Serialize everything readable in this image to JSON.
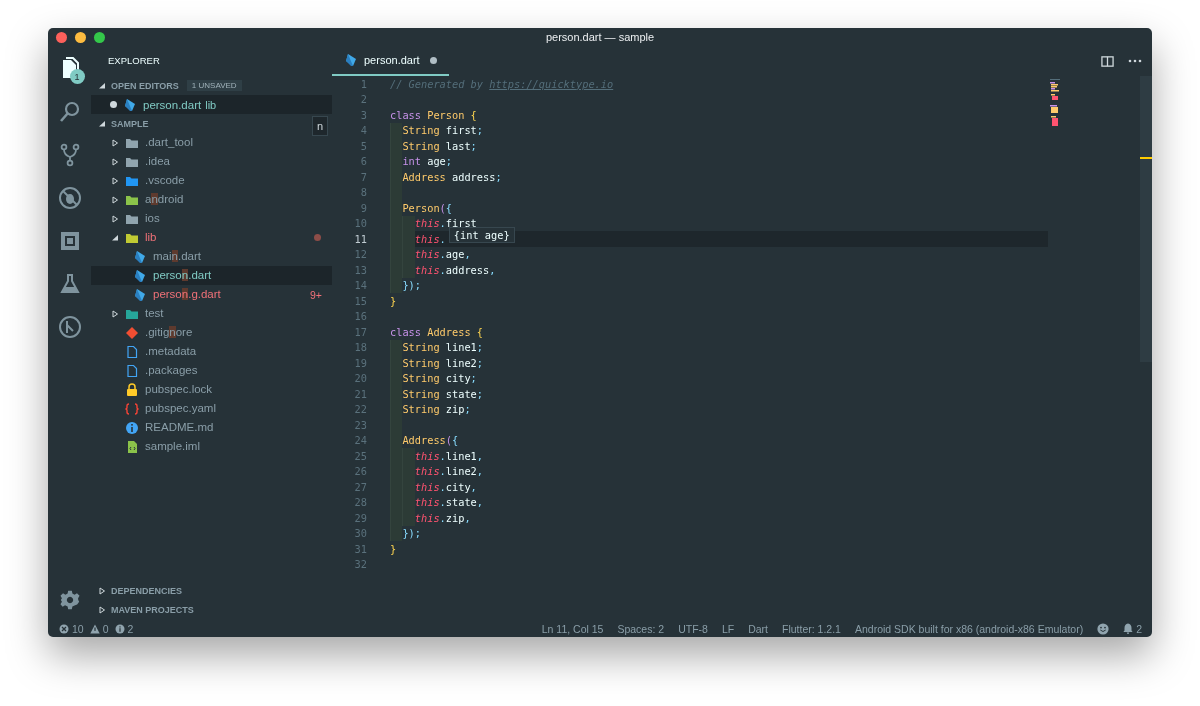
{
  "window": {
    "title": "person.dart — sample"
  },
  "activity_bar": {
    "items": [
      {
        "kind": "files",
        "selected": true,
        "badge": "1"
      },
      {
        "kind": "search",
        "selected": false
      },
      {
        "kind": "source-control",
        "selected": false
      },
      {
        "kind": "debug",
        "selected": false
      },
      {
        "kind": "extensions",
        "selected": false
      },
      {
        "kind": "flask",
        "selected": false
      },
      {
        "kind": "flutter",
        "selected": false
      }
    ]
  },
  "sidebar": {
    "title": "EXPLORER",
    "filter": "n",
    "open_editors": {
      "title": "OPEN EDITORS",
      "badge": "1 UNSAVED",
      "expanded": true,
      "items": [
        {
          "name": "person.dart",
          "folder": "lib",
          "dirty": true,
          "kind": "dart",
          "selected": true
        }
      ]
    },
    "project": {
      "title": "SAMPLE",
      "expanded": true,
      "items": [
        {
          "kind": "folder",
          "name": ".dart_tool",
          "expanded": false,
          "selected": false,
          "modified": false,
          "error": false
        },
        {
          "kind": "folder",
          "name": ".idea",
          "expanded": false,
          "selected": false,
          "modified": false,
          "error": false
        },
        {
          "kind": "folder-vscode",
          "name": ".vscode",
          "expanded": false,
          "selected": false,
          "modified": false,
          "error": false
        },
        {
          "kind": "folder-android",
          "name": "android",
          "expanded": false,
          "selected": false,
          "modified": false,
          "error": false
        },
        {
          "kind": "folder-ios",
          "name": "ios",
          "expanded": false,
          "selected": false,
          "modified": false,
          "error": false
        },
        {
          "kind": "folder-lib",
          "name": "lib",
          "expanded": true,
          "selected": false,
          "modified": false,
          "error": true,
          "children": [
            {
              "kind": "dart",
              "name": "main.dart",
              "selected": false,
              "modified": false,
              "error": false
            },
            {
              "kind": "dart",
              "name": "person.dart",
              "selected": true,
              "modified": true,
              "error": false
            },
            {
              "kind": "dart",
              "name": "person.g.dart",
              "selected": false,
              "modified": false,
              "error": true,
              "badge": "9+"
            }
          ]
        },
        {
          "kind": "folder-test",
          "name": "test",
          "expanded": false,
          "selected": false,
          "modified": false,
          "error": false
        },
        {
          "kind": "git",
          "name": ".gitignore",
          "selected": false,
          "modified": false,
          "error": false
        },
        {
          "kind": "file",
          "name": ".metadata",
          "selected": false,
          "modified": false,
          "error": false
        },
        {
          "kind": "file",
          "name": ".packages",
          "selected": false,
          "modified": false,
          "error": false
        },
        {
          "kind": "lock",
          "name": "pubspec.lock",
          "selected": false,
          "modified": false,
          "error": false
        },
        {
          "kind": "yaml",
          "name": "pubspec.yaml",
          "selected": false,
          "modified": false,
          "error": false
        },
        {
          "kind": "info",
          "name": "README.md",
          "selected": false,
          "modified": false,
          "error": false
        },
        {
          "kind": "xml",
          "name": "sample.iml",
          "selected": false,
          "modified": false,
          "error": false
        }
      ]
    },
    "sections": [
      {
        "title": "DEPENDENCIES",
        "expanded": false
      },
      {
        "title": "MAVEN PROJECTS",
        "expanded": false
      }
    ]
  },
  "editor": {
    "tabs": [
      {
        "name": "person.dart",
        "kind": "dart",
        "dirty": true,
        "selected": true
      }
    ],
    "lines": [
      {
        "number": "1",
        "current": false,
        "tokens": [
          {
            "kind": "comment",
            "text": "// Generated by "
          },
          {
            "kind": "link",
            "text": "https://quicktype.io"
          }
        ]
      },
      {
        "number": "2",
        "current": false
      },
      {
        "number": "3",
        "current": false,
        "tokens": [
          {
            "kind": "keyword",
            "text": "class "
          },
          {
            "kind": "type",
            "text": "Person "
          },
          {
            "kind": "brace",
            "text": "{"
          }
        ],
        "children": [
          {
            "number": "4",
            "current": false,
            "tokens": [
              {
                "kind": "type",
                "text": "String "
              },
              {
                "kind": "plain",
                "text": "first"
              },
              {
                "kind": "punct",
                "text": ";"
              }
            ]
          },
          {
            "number": "5",
            "current": false,
            "tokens": [
              {
                "kind": "type",
                "text": "String "
              },
              {
                "kind": "plain",
                "text": "last"
              },
              {
                "kind": "punct",
                "text": ";"
              }
            ]
          },
          {
            "number": "6",
            "current": false,
            "tokens": [
              {
                "kind": "keyword",
                "text": "int "
              },
              {
                "kind": "plain",
                "text": "age"
              },
              {
                "kind": "punct",
                "text": ";"
              }
            ]
          },
          {
            "number": "7",
            "current": false,
            "tokens": [
              {
                "kind": "type",
                "text": "Address "
              },
              {
                "kind": "plain",
                "text": "address"
              },
              {
                "kind": "punct",
                "text": ";"
              }
            ]
          },
          {
            "number": "8",
            "current": false
          },
          {
            "number": "9",
            "current": false,
            "tokens": [
              {
                "kind": "type",
                "text": "Person"
              },
              {
                "kind": "paren",
                "text": "("
              },
              {
                "kind": "punct",
                "text": "{"
              }
            ],
            "children": [
              {
                "number": "10",
                "current": false,
                "tokens": [
                  {
                    "kind": "this",
                    "text": "this"
                  },
                  {
                    "kind": "punct",
                    "text": "."
                  },
                  {
                    "kind": "plain",
                    "text": "first"
                  }
                ]
              },
              {
                "number": "11",
                "current": true,
                "tokens": [
                  {
                    "kind": "this",
                    "text": "this"
                  },
                  {
                    "kind": "punct",
                    "text": "."
                  }
                ],
                "hover": "{int age}"
              },
              {
                "number": "12",
                "current": false,
                "tokens": [
                  {
                    "kind": "this",
                    "text": "this"
                  },
                  {
                    "kind": "punct",
                    "text": "."
                  },
                  {
                    "kind": "plain",
                    "text": "age"
                  },
                  {
                    "kind": "punct",
                    "text": ","
                  }
                ]
              },
              {
                "number": "13",
                "current": false,
                "tokens": [
                  {
                    "kind": "this",
                    "text": "this"
                  },
                  {
                    "kind": "punct",
                    "text": "."
                  },
                  {
                    "kind": "plain",
                    "text": "address"
                  },
                  {
                    "kind": "punct",
                    "text": ","
                  }
                ]
              }
            ]
          },
          {
            "number": "14",
            "current": false,
            "tokens": [
              {
                "kind": "punct",
                "text": "});"
              }
            ]
          }
        ]
      },
      {
        "number": "15",
        "current": false,
        "tokens": [
          {
            "kind": "brace",
            "text": "}"
          }
        ]
      },
      {
        "number": "16",
        "current": false
      },
      {
        "number": "17",
        "current": false,
        "tokens": [
          {
            "kind": "keyword",
            "text": "class "
          },
          {
            "kind": "type",
            "text": "Address "
          },
          {
            "kind": "brace",
            "text": "{"
          }
        ],
        "children": [
          {
            "number": "18",
            "current": false,
            "tokens": [
              {
                "kind": "type",
                "text": "String "
              },
              {
                "kind": "plain",
                "text": "line1"
              },
              {
                "kind": "punct",
                "text": ";"
              }
            ]
          },
          {
            "number": "19",
            "current": false,
            "tokens": [
              {
                "kind": "type",
                "text": "String "
              },
              {
                "kind": "plain",
                "text": "line2"
              },
              {
                "kind": "punct",
                "text": ";"
              }
            ]
          },
          {
            "number": "20",
            "current": false,
            "tokens": [
              {
                "kind": "type",
                "text": "String "
              },
              {
                "kind": "plain",
                "text": "city"
              },
              {
                "kind": "punct",
                "text": ";"
              }
            ]
          },
          {
            "number": "21",
            "current": false,
            "tokens": [
              {
                "kind": "type",
                "text": "String "
              },
              {
                "kind": "plain",
                "text": "state"
              },
              {
                "kind": "punct",
                "text": ";"
              }
            ]
          },
          {
            "number": "22",
            "current": false,
            "tokens": [
              {
                "kind": "type",
                "text": "String "
              },
              {
                "kind": "plain",
                "text": "zip"
              },
              {
                "kind": "punct",
                "text": ";"
              }
            ]
          },
          {
            "number": "23",
            "current": false
          },
          {
            "number": "24",
            "current": false,
            "tokens": [
              {
                "kind": "type",
                "text": "Address"
              },
              {
                "kind": "paren",
                "text": "("
              },
              {
                "kind": "punct",
                "text": "{"
              }
            ],
            "children": [
              {
                "number": "25",
                "current": false,
                "tokens": [
                  {
                    "kind": "this",
                    "text": "this"
                  },
                  {
                    "kind": "punct",
                    "text": "."
                  },
                  {
                    "kind": "plain",
                    "text": "line1"
                  },
                  {
                    "kind": "punct",
                    "text": ","
                  }
                ]
              },
              {
                "number": "26",
                "current": false,
                "tokens": [
                  {
                    "kind": "this",
                    "text": "this"
                  },
                  {
                    "kind": "punct",
                    "text": "."
                  },
                  {
                    "kind": "plain",
                    "text": "line2"
                  },
                  {
                    "kind": "punct",
                    "text": ","
                  }
                ]
              },
              {
                "number": "27",
                "current": false,
                "tokens": [
                  {
                    "kind": "this",
                    "text": "this"
                  },
                  {
                    "kind": "punct",
                    "text": "."
                  },
                  {
                    "kind": "plain",
                    "text": "city"
                  },
                  {
                    "kind": "punct",
                    "text": ","
                  }
                ]
              },
              {
                "number": "28",
                "current": false,
                "tokens": [
                  {
                    "kind": "this",
                    "text": "this"
                  },
                  {
                    "kind": "punct",
                    "text": "."
                  },
                  {
                    "kind": "plain",
                    "text": "state"
                  },
                  {
                    "kind": "punct",
                    "text": ","
                  }
                ]
              },
              {
                "number": "29",
                "current": false,
                "tokens": [
                  {
                    "kind": "this",
                    "text": "this"
                  },
                  {
                    "kind": "punct",
                    "text": "."
                  },
                  {
                    "kind": "plain",
                    "text": "zip"
                  },
                  {
                    "kind": "punct",
                    "text": ","
                  }
                ]
              }
            ]
          },
          {
            "number": "30",
            "current": false,
            "tokens": [
              {
                "kind": "punct",
                "text": "});"
              }
            ]
          }
        ]
      },
      {
        "number": "31",
        "current": false,
        "tokens": [
          {
            "kind": "brace",
            "text": "}"
          }
        ]
      },
      {
        "number": "32",
        "current": false
      }
    ]
  },
  "status_bar": {
    "problems": [
      {
        "kind": "error",
        "count": "10"
      },
      {
        "kind": "warning",
        "count": "0"
      },
      {
        "kind": "info",
        "count": "2"
      }
    ],
    "items": [
      "Ln 11, Col 15",
      "Spaces: 2",
      "UTF-8",
      "LF",
      "Dart",
      "Flutter: 1.2.1",
      "Android SDK built for x86 (android-x86 Emulator)"
    ],
    "notifications": "2"
  }
}
